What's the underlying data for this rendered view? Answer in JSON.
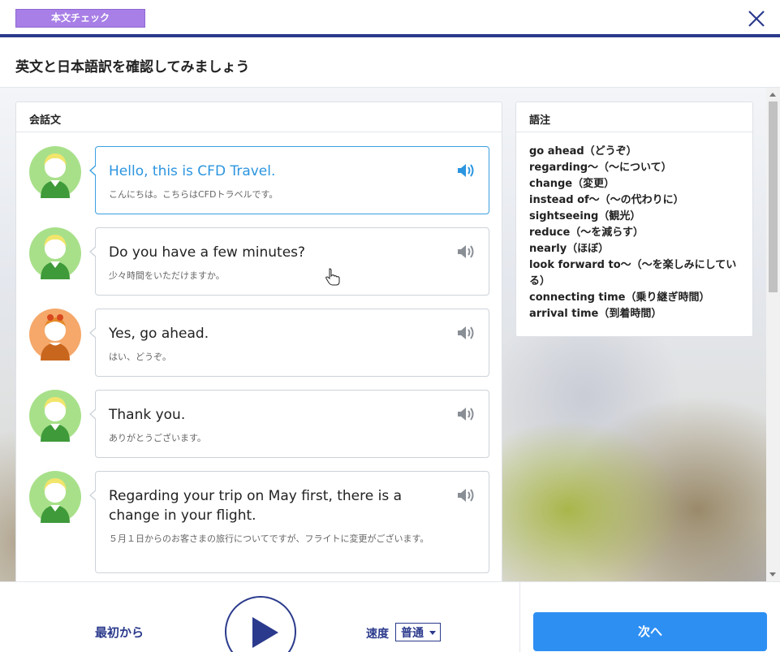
{
  "header": {
    "badge": "本文チェック",
    "title": "英文と日本語訳を確認してみましょう"
  },
  "conversation": {
    "title": "会話文",
    "turns": [
      {
        "speaker": "male",
        "en": "Hello, this is CFD Travel.",
        "ja": "こんにちは。こちらはCFDトラベルです。",
        "active": true
      },
      {
        "speaker": "male",
        "en": "Do you have a few minutes?",
        "ja": "少々時間をいただけますか。",
        "active": false
      },
      {
        "speaker": "female",
        "en": "Yes, go ahead.",
        "ja": "はい、どうぞ。",
        "active": false
      },
      {
        "speaker": "male",
        "en": "Thank you.",
        "ja": "ありがとうございます。",
        "active": false
      },
      {
        "speaker": "male",
        "en": "Regarding your trip on May first, there is a change in your flight.",
        "ja": "５月１日からのお客さまの旅行についてですが、フライトに変更がございます。",
        "active": false
      }
    ]
  },
  "glossary": {
    "title": "語注",
    "items": [
      "go ahead（どうぞ）",
      "regarding〜（〜について）",
      "change（変更）",
      "instead of〜（〜の代わりに）",
      "sightseeing（観光）",
      "reduce（〜を減らす）",
      "nearly（ほぼ）",
      "look forward to〜（〜を楽しみにしている）",
      "connecting time（乗り継ぎ時間）",
      "arrival time（到着時間）"
    ]
  },
  "footer": {
    "restart_label": "最初から",
    "speed_label": "速度",
    "speed_value": "普通",
    "next_label": "次へ"
  },
  "colors": {
    "accent": "#2b3a8c",
    "badge": "#a87fe6",
    "active_text": "#2b95e0",
    "next_button": "#2e8ff3",
    "male_avatar": "#a8e08a",
    "female_avatar": "#f5a86a"
  }
}
